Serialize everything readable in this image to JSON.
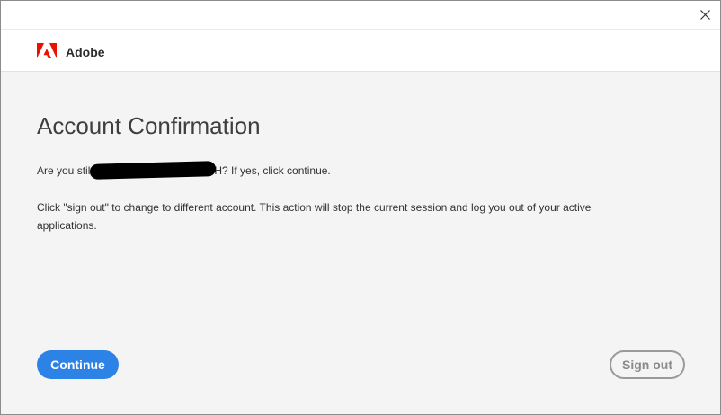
{
  "window": {
    "close_icon": "close-icon"
  },
  "header": {
    "logo_icon": "adobe-logo-icon",
    "brand": "Adobe",
    "brand_color": "#eb1000"
  },
  "main": {
    "title": "Account Confirmation",
    "message_line1_prefix": "Are you stil",
    "message_line1_suffix": "H? If yes, click continue.",
    "message_line2": "Click \"sign out\" to change to different account. This action will stop the current session and log you out of your active applications."
  },
  "actions": {
    "continue_label": "Continue",
    "continue_color": "#2d82e6",
    "signout_label": "Sign out"
  }
}
